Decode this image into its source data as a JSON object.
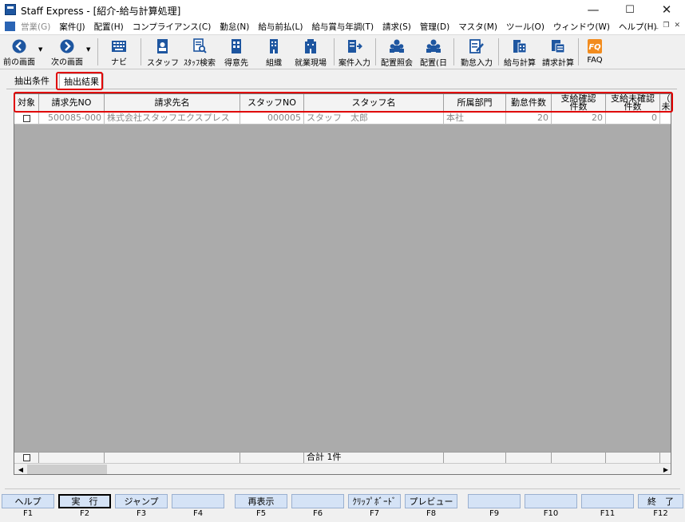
{
  "window": {
    "title": "Staff Express - [紹介-給与計算処理]",
    "controls": {
      "minimize": "—",
      "maximize": "☐",
      "close": "✕"
    }
  },
  "menu": {
    "items": [
      {
        "label": "営業(G)",
        "enabled": false
      },
      {
        "label": "案件(J)",
        "enabled": true
      },
      {
        "label": "配置(H)",
        "enabled": true
      },
      {
        "label": "コンプライアンス(C)",
        "enabled": true
      },
      {
        "label": "勤怠(N)",
        "enabled": true
      },
      {
        "label": "給与前払(L)",
        "enabled": true
      },
      {
        "label": "給与賞与年調(T)",
        "enabled": true
      },
      {
        "label": "請求(S)",
        "enabled": true
      },
      {
        "label": "管理(D)",
        "enabled": true
      },
      {
        "label": "マスタ(M)",
        "enabled": true
      },
      {
        "label": "ツール(O)",
        "enabled": true
      },
      {
        "label": "ウィンドウ(W)",
        "enabled": true
      },
      {
        "label": "ヘルプ(H)",
        "enabled": true
      }
    ],
    "mdi": {
      "minimize": "_",
      "restore": "❐",
      "close": "✕"
    }
  },
  "toolbar": {
    "back": "前の画面",
    "forward": "次の画面",
    "navi": "ナビ",
    "staff": "スタッフ",
    "staff_search": "ｽﾀｯﾌ検索",
    "customer": "得意先",
    "organization": "組織",
    "worksite": "就業現場",
    "case_input": "案件入力",
    "assign_inquiry": "配置照会",
    "assign_day": "配置(日",
    "attendance_input": "勤怠入力",
    "payroll_calc": "給与計算",
    "billing_calc": "請求計算",
    "faq": "FAQ"
  },
  "tabs": {
    "conditions": "抽出条件",
    "results": "抽出結果"
  },
  "grid": {
    "headers": {
      "target": "対象",
      "billing_no": "請求先NO",
      "billing_name": "請求先名",
      "staff_no": "スタッフNO",
      "staff_name": "スタッフ名",
      "department": "所属部門",
      "attendance_count": "勤怠件数",
      "pay_confirmed": "支給確認\n件数",
      "pay_unconfirmed": "支給未確認\n件数",
      "extra": "（\n未"
    },
    "rows": [
      {
        "checked": false,
        "billing_no": "500085-000",
        "billing_name": "株式会社スタッフエクスプレス",
        "staff_no": "000005",
        "staff_name": "スタッフ　太郎",
        "department": "本社",
        "attendance_count": "20",
        "pay_confirmed": "20",
        "pay_unconfirmed": "0"
      }
    ],
    "footer_total": "合計 1件"
  },
  "function_keys": [
    {
      "key": "F1",
      "label": "ヘルプ"
    },
    {
      "key": "F2",
      "label": "実　行"
    },
    {
      "key": "F3",
      "label": "ジャンプ"
    },
    {
      "key": "F4",
      "label": ""
    },
    {
      "key": "F5",
      "label": "再表示"
    },
    {
      "key": "F6",
      "label": ""
    },
    {
      "key": "F7",
      "label": "ｸﾘｯﾌﾟﾎﾞｰﾄﾞ"
    },
    {
      "key": "F8",
      "label": "プレビュー"
    },
    {
      "key": "F9",
      "label": ""
    },
    {
      "key": "F10",
      "label": ""
    },
    {
      "key": "F11",
      "label": ""
    },
    {
      "key": "F12",
      "label": "終　了"
    }
  ],
  "colors": {
    "highlight": "#e00000",
    "grid_background": "#ababab",
    "fkey_background": "#d5e3f6",
    "icon_blue": "#1e56a0"
  }
}
